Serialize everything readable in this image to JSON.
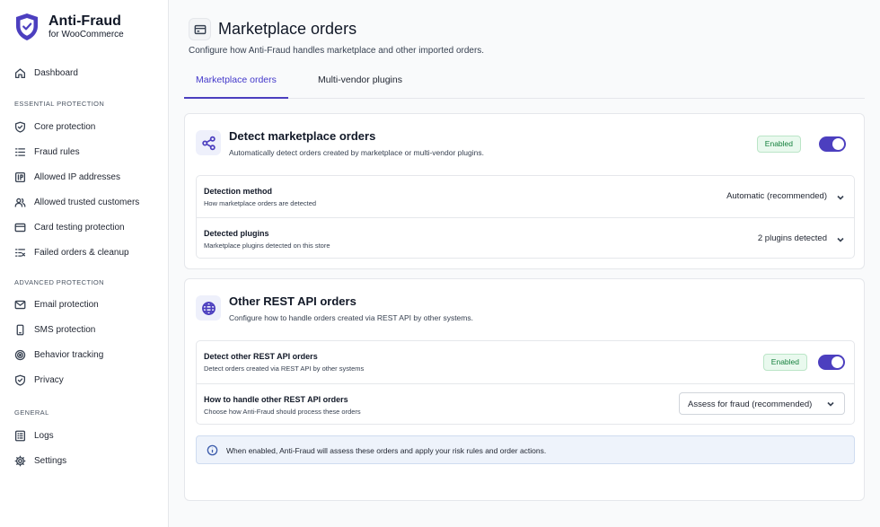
{
  "brand": {
    "name": "Anti-Fraud",
    "subtitle": "for WooCommerce"
  },
  "sidebar": {
    "dashboard": "Dashboard",
    "section_essential": "ESSENTIAL PROTECTION",
    "essential": [
      "Core protection",
      "Fraud rules",
      "Allowed IP addresses",
      "Allowed trusted customers",
      "Card testing protection",
      "Failed orders & cleanup"
    ],
    "section_advanced": "ADVANCED PROTECTION",
    "advanced": [
      "Email protection",
      "SMS protection",
      "Behavior tracking",
      "Privacy"
    ],
    "section_general": "GENERAL",
    "general": [
      "Logs",
      "Settings"
    ]
  },
  "page": {
    "title": "Marketplace orders",
    "description": "Configure how Anti-Fraud handles marketplace and other imported orders."
  },
  "tabs": [
    {
      "label": "Marketplace orders",
      "active": true
    },
    {
      "label": "Multi-vendor plugins",
      "active": false
    }
  ],
  "detect_card": {
    "title": "Detect marketplace orders",
    "description": "Automatically detect orders created by marketplace or multi-vendor plugins.",
    "badge": "Enabled",
    "rows": [
      {
        "label": "Detection method",
        "sub": "How marketplace orders are detected",
        "value": "Automatic (recommended)"
      },
      {
        "label": "Detected plugins",
        "sub": "Marketplace plugins detected on this store",
        "value": "2 plugins detected"
      }
    ]
  },
  "rest_card": {
    "title": "Other REST API orders",
    "description": "Configure how to handle orders created via REST API by other systems.",
    "detect_row": {
      "label": "Detect other REST API orders",
      "sub": "Detect orders created via REST API by other systems",
      "badge": "Enabled"
    },
    "handle_row": {
      "label": "How to handle other REST API orders",
      "sub": "Choose how Anti-Fraud should process these orders",
      "value": "Assess for fraud (recommended)"
    },
    "info": "When enabled, Anti-Fraud will assess these orders and apply your risk rules and order actions."
  },
  "colors": {
    "accent": "#4c3fbf",
    "enabled_text": "#15803d",
    "enabled_bg": "#e9f9ee",
    "info_bg": "#eef3fb"
  }
}
